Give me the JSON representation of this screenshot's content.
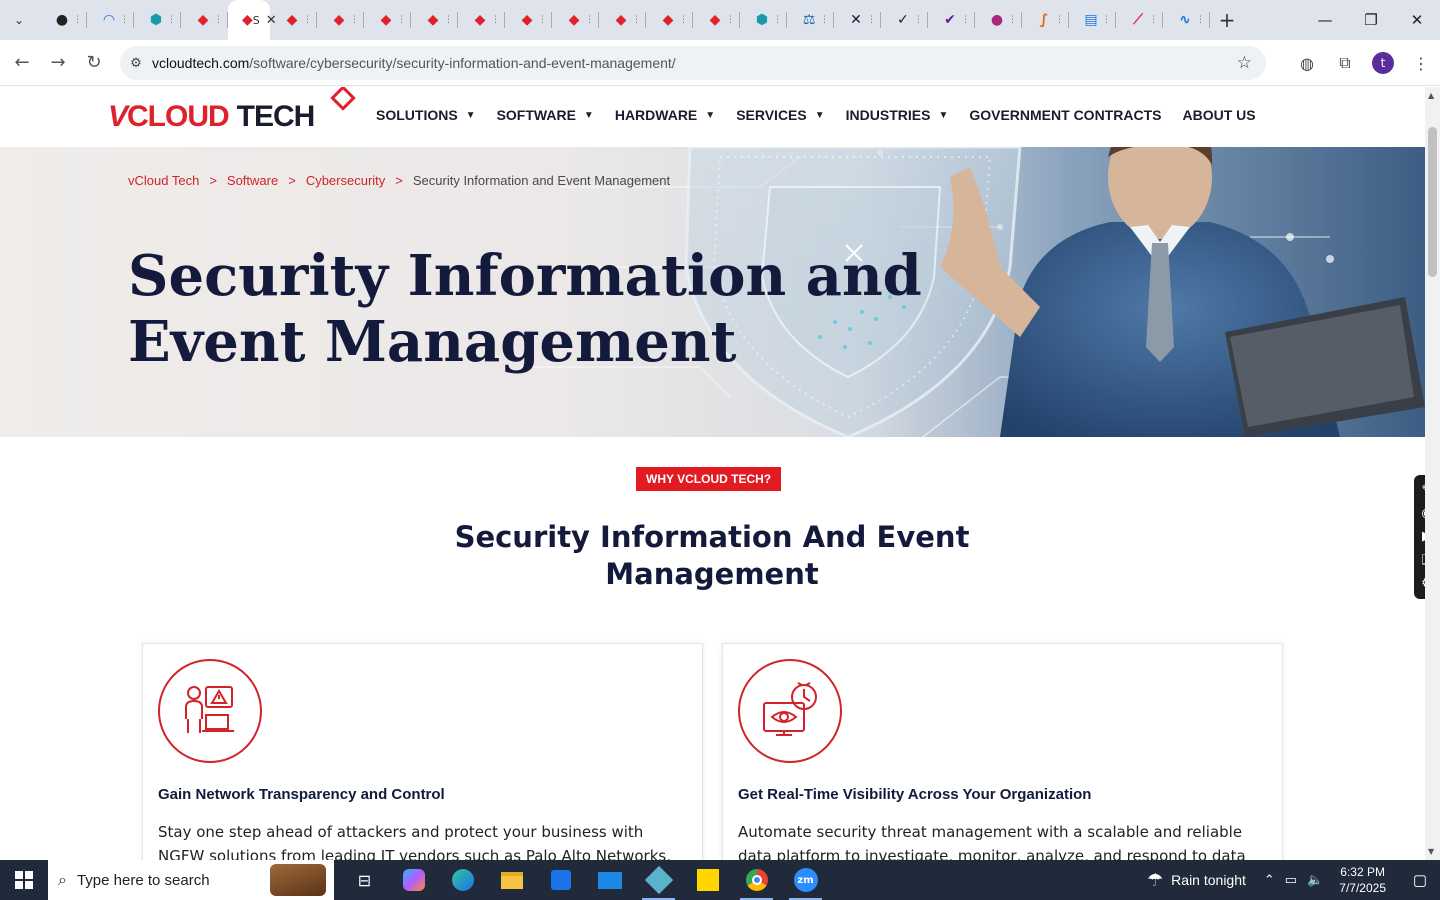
{
  "browser": {
    "tabs": [
      {
        "icon": "github-icon",
        "color": "#222222",
        "glyph": "●"
      },
      {
        "icon": "speedometer-icon",
        "color": "#1a73e8",
        "glyph": "◠"
      },
      {
        "icon": "hexagon-icon",
        "color": "#1b9aaa",
        "glyph": "⬢"
      },
      {
        "icon": "vcloud-icon",
        "color": "#e0202a",
        "glyph": "◆"
      },
      {
        "icon": "vcloud-icon",
        "color": "#e0202a",
        "glyph": "◆",
        "active": true,
        "label": "S"
      },
      {
        "icon": "vcloud-icon",
        "color": "#e0202a",
        "glyph": "◆"
      },
      {
        "icon": "vcloud-icon",
        "color": "#e0202a",
        "glyph": "◆"
      },
      {
        "icon": "vcloud-icon",
        "color": "#e0202a",
        "glyph": "◆"
      },
      {
        "icon": "vcloud-icon",
        "color": "#e0202a",
        "glyph": "◆"
      },
      {
        "icon": "vcloud-icon",
        "color": "#e0202a",
        "glyph": "◆"
      },
      {
        "icon": "vcloud-icon",
        "color": "#e0202a",
        "glyph": "◆"
      },
      {
        "icon": "vcloud-icon",
        "color": "#e0202a",
        "glyph": "◆"
      },
      {
        "icon": "vcloud-icon",
        "color": "#e0202a",
        "glyph": "◆"
      },
      {
        "icon": "vcloud-icon",
        "color": "#e0202a",
        "glyph": "◆"
      },
      {
        "icon": "vcloud-icon",
        "color": "#e0202a",
        "glyph": "◆"
      },
      {
        "icon": "hexagon-icon",
        "color": "#1b9aaa",
        "glyph": "⬢"
      },
      {
        "icon": "scales-icon",
        "color": "#1a5fb4",
        "glyph": "⚖"
      },
      {
        "icon": "x-icon",
        "color": "#1b1d2e",
        "glyph": "✕"
      },
      {
        "icon": "check-icon",
        "color": "#1b1d2e",
        "glyph": "✓"
      },
      {
        "icon": "checkmark-icon",
        "color": "#6a1b9a",
        "glyph": "✔"
      },
      {
        "icon": "pill-icon",
        "color": "#a52a7a",
        "glyph": "●"
      },
      {
        "icon": "pen-icon",
        "color": "#e8630a",
        "glyph": "∫"
      },
      {
        "icon": "document-icon",
        "color": "#1a73e8",
        "glyph": "▤"
      },
      {
        "icon": "brush-icon",
        "color": "#e91e63",
        "glyph": "⟋"
      },
      {
        "icon": "activity-icon",
        "color": "#1a73e8",
        "glyph": "∿"
      }
    ],
    "url_host": "vcloudtech.com",
    "url_path": "/software/cybersecurity/security-information-and-event-management/",
    "profile_initial": "t"
  },
  "site": {
    "logo": {
      "v": "V",
      "cloud": "CLOUD",
      "tech": "TECH"
    },
    "nav": [
      {
        "label": "SOLUTIONS",
        "dropdown": true
      },
      {
        "label": "SOFTWARE",
        "dropdown": true
      },
      {
        "label": "HARDWARE",
        "dropdown": true
      },
      {
        "label": "SERVICES",
        "dropdown": true
      },
      {
        "label": "INDUSTRIES",
        "dropdown": true
      },
      {
        "label": "GOVERNMENT CONTRACTS",
        "dropdown": false
      },
      {
        "label": "ABOUT US",
        "dropdown": false
      }
    ],
    "breadcrumb": {
      "items": [
        "vCloud Tech",
        "Software",
        "Cybersecurity"
      ],
      "separator": ">",
      "current": "Security Information and Event Management"
    },
    "hero_title": "Security Information and Event Management",
    "why_badge": "WHY VCLOUD TECH?",
    "why_title": "Security Information And Event Management",
    "cards": [
      {
        "icon": "alert-laptop-icon",
        "title": "Gain Network Transparency and Control",
        "text": "Stay one step ahead of attackers and protect your business with NGFW solutions from leading IT vendors such as Palo Alto Networks,"
      },
      {
        "icon": "eye-monitor-icon",
        "title": "Get Real-Time Visibility Across Your Organization",
        "text": "Automate security threat management with a scalable and reliable data platform to investigate, monitor, analyze, and respond to data"
      }
    ],
    "brand_red": "#e21b22",
    "brand_navy": "#141a3b"
  },
  "taskbar": {
    "search_placeholder": "Type here to search",
    "weather": "Rain tonight",
    "time": "6:32 PM",
    "date": "7/7/2025"
  }
}
